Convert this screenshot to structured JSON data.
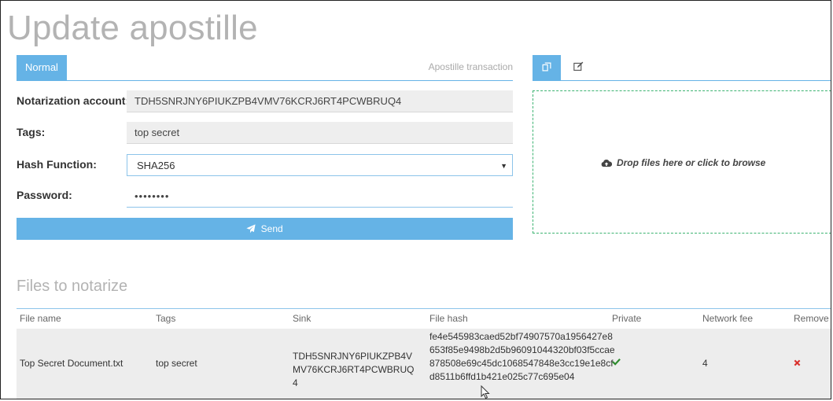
{
  "page": {
    "title": "Update apostille"
  },
  "form": {
    "tabs": {
      "normal": "Normal",
      "apostille": "Apostille transaction"
    },
    "notarization_account": {
      "label": "Notarization account:",
      "value": "TDH5SNRJNY6PIUKZPB4VMV76KCRJ6RT4PCWBRUQ4"
    },
    "tags": {
      "label": "Tags:",
      "value": "top secret"
    },
    "hash_function": {
      "label": "Hash Function:",
      "value": "SHA256"
    },
    "password": {
      "label": "Password:",
      "value": "••••••••"
    },
    "send_label": "Send",
    "send_icon": "paper-plane-icon"
  },
  "right_panel": {
    "tab_icons": [
      "copy-files-icon",
      "edit-icon"
    ],
    "drop_text": "Drop files here or click to browse",
    "drop_icon": "cloud-upload-icon"
  },
  "files": {
    "title": "Files to notarize",
    "columns": [
      "File name",
      "Tags",
      "Sink",
      "File hash",
      "Private",
      "Network fee",
      "Remove"
    ],
    "rows": [
      {
        "file_name": "Top Secret Document.txt",
        "tags": "top secret",
        "sink": "TDH5SNRJNY6PIUKZPB4VMV76KCRJ6RT4PCWBRUQ4",
        "file_hash": "fe4e545983caed52bf74907570a1956427e8653f85e9498b2d5b96091044320bf03f5ccae878508e69c45dc1068547848e3cc19e1e8cfd8511b6ffd1b421e025c77c695e04",
        "private_icon": "check-icon",
        "network_fee": "4",
        "remove_icon": "remove-icon"
      }
    ]
  },
  "colors": {
    "accent": "#65b3e6",
    "success": "#2e8b2e",
    "danger": "#d9302c",
    "dropzone_border": "#3cb371"
  }
}
